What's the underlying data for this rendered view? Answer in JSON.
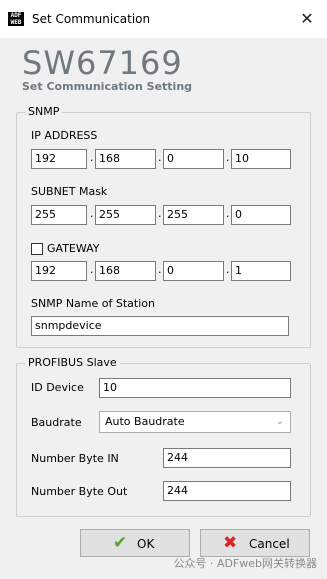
{
  "window": {
    "title": "Set Communication",
    "icon_label": "ADF\nWEB",
    "close_glyph": "✕"
  },
  "header": {
    "title": "SW67169",
    "subtitle": "Set Communication Setting"
  },
  "snmp": {
    "legend": "SNMP",
    "ip_label": "IP ADDRESS",
    "ip": [
      "192",
      "168",
      "0",
      "10"
    ],
    "subnet_label": "SUBNET Mask",
    "subnet": [
      "255",
      "255",
      "255",
      "0"
    ],
    "gateway_label": "GATEWAY",
    "gateway_checked": false,
    "gateway": [
      "192",
      "168",
      "0",
      "1"
    ],
    "station_label": "SNMP Name of Station",
    "station_value": "snmpdevice",
    "dot": "."
  },
  "profibus": {
    "legend": "PROFIBUS Slave",
    "id_label": "ID Device",
    "id_value": "10",
    "baud_label": "Baudrate",
    "baud_value": "Auto Baudrate",
    "byte_in_label": "Number Byte IN",
    "byte_in_value": "244",
    "byte_out_label": "Number Byte Out",
    "byte_out_value": "244"
  },
  "buttons": {
    "ok_label": "OK",
    "ok_icon": "checkmark-icon",
    "cancel_label": "Cancel",
    "cancel_icon": "red-x-icon"
  },
  "colors": {
    "header_gray": "#6f7a80",
    "ok_green": "#5aa02c",
    "cancel_red": "#d9262b"
  },
  "watermark": "公众号 · ADFweb网关转换器"
}
